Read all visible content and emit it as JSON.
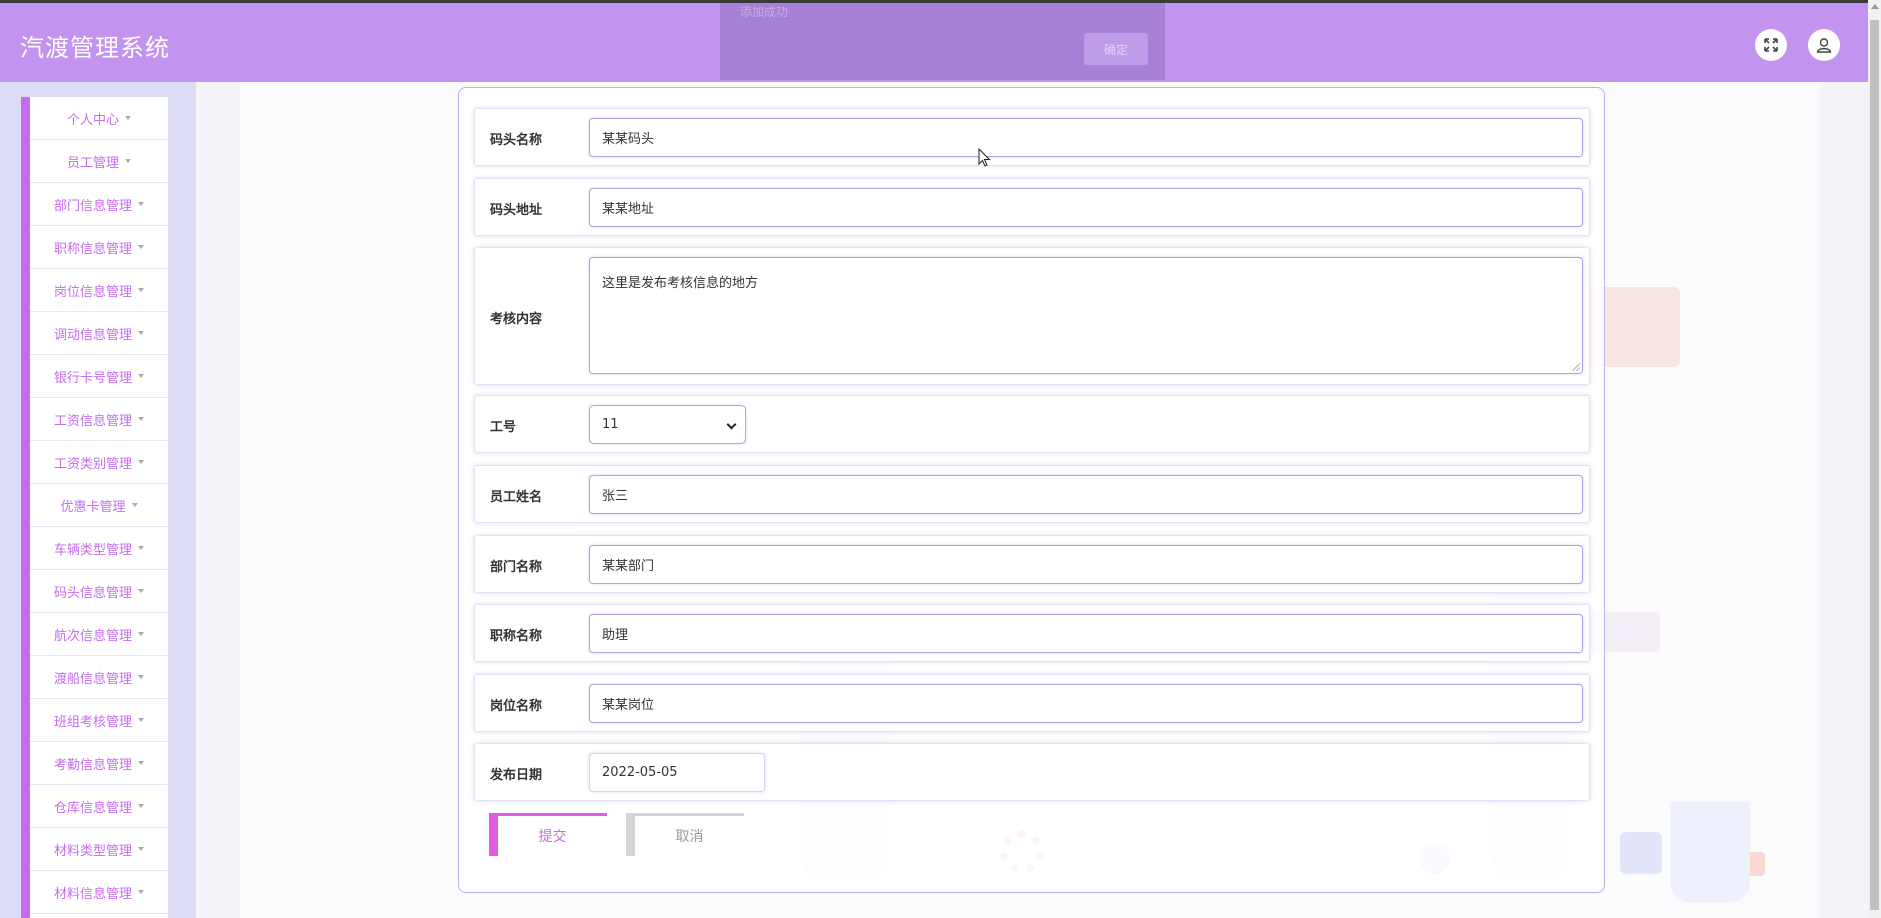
{
  "header": {
    "title": "汽渡管理系统",
    "bg_color": "#c393f0",
    "fullscreen_icon": "expand-icon",
    "user_icon": "user-icon"
  },
  "toast": {
    "message": "添加成功",
    "confirm_label": "确定"
  },
  "sidebar": {
    "accent_color": "#c56cf0",
    "items": [
      {
        "label": "个人中心"
      },
      {
        "label": "员工管理"
      },
      {
        "label": "部门信息管理"
      },
      {
        "label": "职称信息管理"
      },
      {
        "label": "岗位信息管理"
      },
      {
        "label": "调动信息管理"
      },
      {
        "label": "银行卡号管理"
      },
      {
        "label": "工资信息管理"
      },
      {
        "label": "工资类别管理"
      },
      {
        "label": "优惠卡管理"
      },
      {
        "label": "车辆类型管理"
      },
      {
        "label": "码头信息管理"
      },
      {
        "label": "航次信息管理"
      },
      {
        "label": "渡船信息管理"
      },
      {
        "label": "班组考核管理"
      },
      {
        "label": "考勤信息管理"
      },
      {
        "label": "仓库信息管理"
      },
      {
        "label": "材料类型管理"
      },
      {
        "label": "材料信息管理"
      }
    ]
  },
  "form": {
    "pier_name": {
      "label": "码头名称",
      "value": "某某码头"
    },
    "pier_address": {
      "label": "码头地址",
      "value": "某某地址"
    },
    "assessment_content": {
      "label": "考核内容",
      "value": "这里是发布考核信息的地方"
    },
    "employee_id": {
      "label": "工号",
      "value": "11"
    },
    "employee_name": {
      "label": "员工姓名",
      "value": "张三"
    },
    "department_name": {
      "label": "部门名称",
      "value": "某某部门"
    },
    "title_name": {
      "label": "职称名称",
      "value": "助理"
    },
    "position_name": {
      "label": "岗位名称",
      "value": "某某岗位"
    },
    "publish_date": {
      "label": "发布日期",
      "value": "2022-05-05"
    },
    "submit_label": "提交",
    "cancel_label": "取消"
  }
}
